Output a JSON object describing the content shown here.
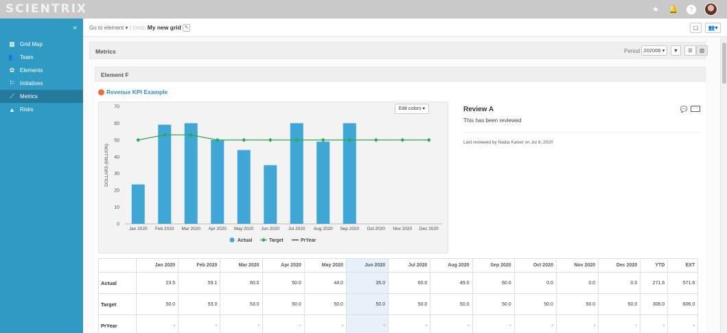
{
  "app": {
    "logo": "SCIENTRIX"
  },
  "top_icons": [
    "star-icon",
    "bell-icon",
    "help-icon",
    "avatar"
  ],
  "sidebar": {
    "collapse_label": "«",
    "items": [
      {
        "label": "Grid Map",
        "icon": "grid-icon"
      },
      {
        "label": "Team",
        "icon": "team-icon"
      },
      {
        "label": "Elements",
        "icon": "elements-icon"
      },
      {
        "label": "Initiatives",
        "icon": "initiatives-icon"
      },
      {
        "label": "Metrics",
        "icon": "chart-line-icon",
        "active": true
      },
      {
        "label": "Risks",
        "icon": "warning-icon"
      }
    ]
  },
  "toolbar": {
    "goto_label": "Go to element",
    "grid_label": "GRID:",
    "grid_name": "My new grid"
  },
  "metrics": {
    "title": "Metrics",
    "period_label": "Period",
    "period_value": "202006"
  },
  "element": {
    "title": "Element F"
  },
  "kpi": {
    "title": "Revenue KPI Example",
    "status_color": "#ee6a3a",
    "edit_colors_label": "Edit colors"
  },
  "review": {
    "title": "Review A",
    "text": "This has been reviewed",
    "footer": "Last reviewed by Nadia Kaiser on Jul 8, 2020"
  },
  "chart_data": {
    "type": "bar",
    "categories": [
      "Jan 2020",
      "Feb 2020",
      "Mar 2020",
      "Apr 2020",
      "May 2020",
      "Jun 2020",
      "Jul 2020",
      "Aug 2020",
      "Sep 2020",
      "Oct 2020",
      "Nov 2020",
      "Dec 2020"
    ],
    "series": [
      {
        "name": "Actual",
        "kind": "bar",
        "color": "#3ea7d6",
        "values": [
          23.5,
          59.1,
          60.0,
          50.0,
          44.0,
          35.0,
          60.0,
          49.0,
          60.0,
          null,
          null,
          null
        ]
      },
      {
        "name": "Target",
        "kind": "line",
        "color": "#2ea84a",
        "values": [
          50.0,
          53.0,
          53.0,
          50.0,
          50.0,
          50.0,
          50.0,
          50.0,
          50.0,
          50.0,
          50.0,
          50.0
        ]
      },
      {
        "name": "PrYear",
        "kind": "line",
        "color": "#333333",
        "values": []
      }
    ],
    "ylabel": "DOLLARS (MILLION)",
    "ylim": [
      0,
      70
    ],
    "yticks": [
      0,
      10,
      20,
      30,
      40,
      50,
      60,
      70
    ],
    "legend": "bottom",
    "grid": false
  },
  "table": {
    "columns": [
      "Jan 2020",
      "Feb 2020",
      "Mar 2020",
      "Apr 2020",
      "May 2020",
      "Jun 2020",
      "Jul 2020",
      "Aug 2020",
      "Sep 2020",
      "Oct 2020",
      "Nov 2020",
      "Dec 2020",
      "YTD",
      "EXT"
    ],
    "highlight_column": "Jun 2020",
    "rows": [
      {
        "label": "Actual",
        "values": [
          "23.5",
          "59.1",
          "60.0",
          "50.0",
          "44.0",
          "35.0",
          "60.0",
          "49.0",
          "60.0",
          "0.0",
          "0.0",
          "0.0",
          "271.6",
          "571.6"
        ]
      },
      {
        "label": "Target",
        "values": [
          "50.0",
          "53.0",
          "53.0",
          "50.0",
          "50.0",
          "50.0",
          "50.0",
          "50.0",
          "50.0",
          "50.0",
          "50.0",
          "50.0",
          "306.0",
          "606.0"
        ]
      },
      {
        "label": "PrYear",
        "values": [
          "-",
          "-",
          "-",
          "-",
          "-",
          "-",
          "-",
          "-",
          "-",
          "-",
          "-",
          "-",
          "-",
          "-"
        ]
      }
    ]
  }
}
